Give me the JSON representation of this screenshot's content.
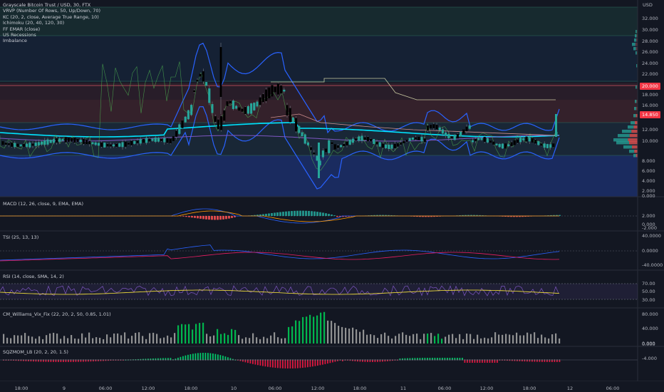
{
  "legend": {
    "title": "Grayscale Bitcoin Trust / USD, 30, FTX",
    "lines": [
      "VRVP (Number Of Rows, 50, Up/Down, 70)",
      "KC (20, 2, close, Average True Range, 10)",
      "Ichimoku (20, 40, 120, 30)",
      "FF EMAR (close)",
      "US Recessions",
      "Imbalance"
    ]
  },
  "currency": "USD",
  "price_axis": [
    "32.000",
    "30.000",
    "28.000",
    "26.000",
    "24.000",
    "22.000",
    "18.000",
    "16.000",
    "12.000",
    "10.000",
    "8.000",
    "6.000",
    "4.000",
    "2.000",
    "0.000"
  ],
  "price_badges": [
    {
      "value": "20.000",
      "color": "#f23645"
    },
    {
      "value": "14.850",
      "color": "#f23645"
    }
  ],
  "panes": {
    "macd": {
      "label": "MACD (12, 26, close, 9, EMA, EMA)",
      "ticks": [
        "2.000",
        "0.000",
        "-2.000"
      ]
    },
    "tsi": {
      "label": "TSI (25, 13, 13)",
      "ticks": [
        "40.0000",
        "0.0000",
        "-40.0000"
      ]
    },
    "rsi": {
      "label": "RSI (14, close, SMA, 14, 2)",
      "ticks": [
        "70.00",
        "50.00",
        "30.00"
      ]
    },
    "vix": {
      "label": "CM_Williams_Vix_Fix (22, 20, 2, 50, 0.85, 1.01)",
      "ticks": [
        "80.000",
        "40.000",
        "0.000"
      ]
    },
    "sqz": {
      "label": "SQZMOM_LB (20, 2, 20, 1.5)",
      "ticks": [
        "0.000",
        "-4.000"
      ]
    }
  },
  "time_axis": [
    "18:00",
    "9",
    "06:00",
    "12:00",
    "18:00",
    "10",
    "06:00",
    "12:00",
    "18:00",
    "11",
    "06:00",
    "12:00",
    "18:00",
    "12",
    "06:00"
  ],
  "colors": {
    "bg": "#131722",
    "up": "#26a69a",
    "down": "#ef5350",
    "blue": "#2962ff",
    "cyan": "#00e5ff"
  }
}
